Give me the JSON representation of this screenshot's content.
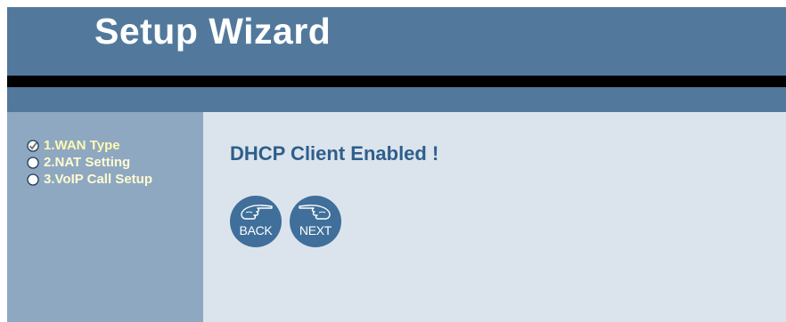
{
  "header": {
    "title": "Setup Wizard"
  },
  "sidebar": {
    "steps": [
      {
        "label": "1.WAN Type",
        "state": "checked",
        "icon": "radio-checked-icon"
      },
      {
        "label": "2.NAT Setting",
        "state": "unchecked",
        "icon": "radio-empty-icon"
      },
      {
        "label": "3.VoIP Call Setup",
        "state": "unchecked",
        "icon": "radio-empty-icon"
      }
    ]
  },
  "main": {
    "message": "DHCP Client Enabled !",
    "buttons": {
      "back_label": "BACK",
      "next_label": "NEXT",
      "icon": "pointing-hand-icon"
    }
  },
  "colors": {
    "header_bg": "#52799c",
    "sidebar_bg": "#8ea8c1",
    "content_bg": "#dbe4ec",
    "message_text": "#2e5e8c",
    "step_text": "#fff9b0",
    "button_bg": "#3f6f9a"
  }
}
